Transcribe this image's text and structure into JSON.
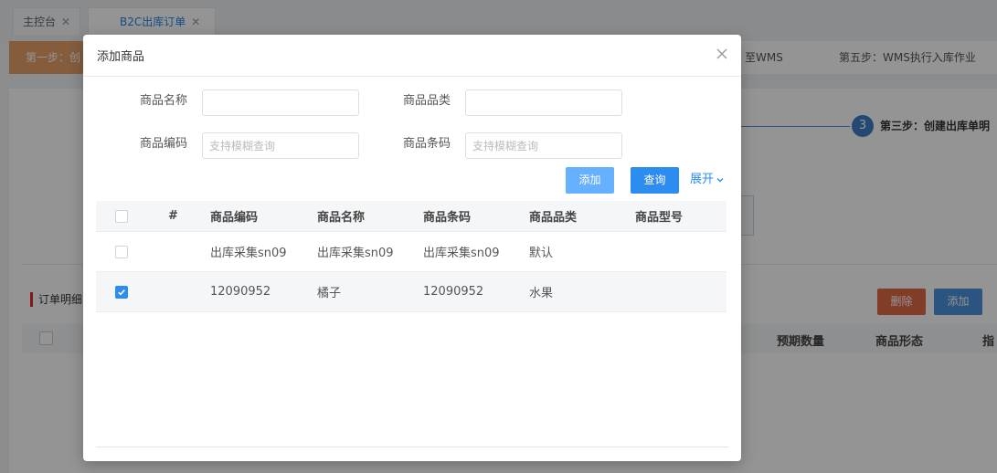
{
  "tabs": [
    {
      "label": "主控台",
      "active": false
    },
    {
      "label": "B2C出库订单",
      "active": true
    }
  ],
  "steps": {
    "step1_label": "第一步：创",
    "step4_fragment": "至WMS",
    "step5_label": "第五步：WMS执行入库作业"
  },
  "progress": {
    "number": "3",
    "label": "第三步：创建出库单明"
  },
  "background_section": {
    "order_detail_label": "订单明细",
    "delete_button": "删除",
    "add_button": "添加",
    "columns": [
      "预期数量",
      "商品形态",
      "指"
    ]
  },
  "modal": {
    "title": "添加商品",
    "filters": {
      "name_label": "商品名称",
      "name_value": "",
      "category_label": "商品品类",
      "category_value": "",
      "code_label": "商品编码",
      "code_placeholder": "支持模糊查询",
      "barcode_label": "商品条码",
      "barcode_placeholder": "支持模糊查询"
    },
    "buttons": {
      "add": "添加",
      "query": "查询",
      "expand": "展开"
    },
    "table": {
      "columns": [
        "#",
        "商品编码",
        "商品名称",
        "商品条码",
        "商品品类",
        "商品型号"
      ],
      "rows": [
        {
          "code": "出库采集sn09",
          "name": "出库采集sn09",
          "barcode": "出库采集sn09",
          "category": "默认",
          "model": "",
          "checked": false
        },
        {
          "code": "12090952",
          "name": "橘子",
          "barcode": "12090952",
          "category": "水果",
          "model": "",
          "checked": true
        }
      ]
    }
  },
  "colors": {
    "primary": "#2d8cf0",
    "primary_light": "#66b1ff",
    "danger": "#e06a47",
    "step_active": "#e6a16a"
  }
}
